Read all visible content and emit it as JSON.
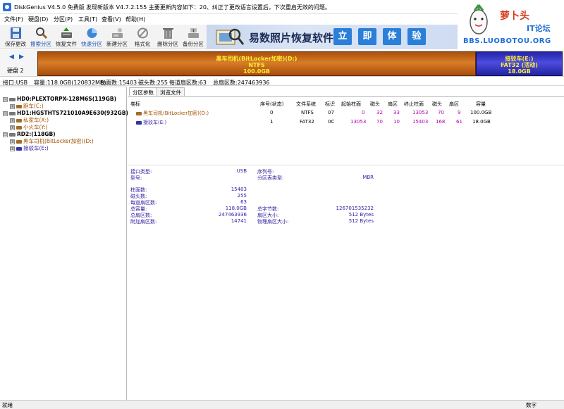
{
  "window": {
    "title": "DiskGenius V4.5.0 免费版",
    "notice": "发现新版本 V4.7.2.155 主要更新内容如下：20、纠正了更改语言设置后，下次重启无效的问题。",
    "minimize": "—",
    "maximize": "☐",
    "close": "✕"
  },
  "menu": [
    "文件(F)",
    "硬盘(D)",
    "分区(P)",
    "工具(T)",
    "查看(V)",
    "帮助(H)"
  ],
  "toolbar": [
    {
      "label": "保存更改",
      "icon": "save-icon"
    },
    {
      "label": "搜索分区",
      "icon": "search-partition-icon"
    },
    {
      "label": "恢复文件",
      "icon": "recover-files-icon"
    },
    {
      "label": "快速分区",
      "icon": "quick-partition-icon"
    },
    {
      "label": "新建分区",
      "icon": "new-partition-icon"
    },
    {
      "label": "格式化",
      "icon": "format-icon"
    },
    {
      "label": "删除分区",
      "icon": "delete-partition-icon"
    },
    {
      "label": "备份分区",
      "icon": "backup-partition-icon"
    }
  ],
  "ad": {
    "text": "易数照片恢复软件",
    "chars": [
      "立",
      "即",
      "体",
      "验"
    ]
  },
  "logo": {
    "title": "萝卜头",
    "sub": "IT论坛",
    "url": "BBS.LUOBOTOU.ORG"
  },
  "diskbar": {
    "label": "硬盘 2",
    "partitions": [
      {
        "name": "黑车司机(BitLocker加密)(D:)",
        "fs": "NTFS",
        "size": "100.0GB"
      },
      {
        "name": "接驳车(E:)",
        "fs": "FAT32 (活动)",
        "size": "18.0GB"
      }
    ]
  },
  "infostrip": {
    "interface": "接口:USB",
    "capacity": "容量:118.0GB(120832MB)",
    "cylinders": "柱面数:15403",
    "heads": "磁头数:255",
    "sectors_per_track": "每道扇区数:63",
    "total_sectors": "总扇区数:247463936"
  },
  "tree": [
    {
      "label": "HD0:PLEXTORPX-128M6S(119GB)",
      "kind": "disk",
      "expander": "⊟"
    },
    {
      "label": "跑车(C:)",
      "kind": "part",
      "expander": "⊞"
    },
    {
      "label": "HD1:HGSTHTS721010A9E630(932GB)",
      "kind": "disk",
      "expander": "⊟"
    },
    {
      "label": "私家车(X:)",
      "kind": "part",
      "expander": "⊞"
    },
    {
      "label": "小火车(Y:)",
      "kind": "part",
      "expander": "⊞"
    },
    {
      "label": "RD2:(118GB)",
      "kind": "disk",
      "expander": "⊟"
    },
    {
      "label": "黑车司机(BitLocker加密)(D:)",
      "kind": "part",
      "expander": "⊞"
    },
    {
      "label": "接驳车(E:)",
      "kind": "part",
      "expander": "⊞"
    }
  ],
  "tabs": [
    "分区参数",
    "浏览文件"
  ],
  "table": {
    "headers": [
      "卷标",
      "序号(状态)",
      "文件系统",
      "标识",
      "起始柱面",
      "磁头",
      "扇区",
      "终止柱面",
      "磁头",
      "扇区",
      "容量"
    ],
    "rows": [
      {
        "label": "黑车司机(BitLocker加密)(D:)",
        "index": "0",
        "fs": "NTFS",
        "id": "07",
        "start_cyl": "0",
        "start_head": "32",
        "start_sec": "33",
        "end_cyl": "13053",
        "end_head": "70",
        "end_sec": "9",
        "capacity": "100.0GB"
      },
      {
        "label": "接驳车(E:)",
        "index": "1",
        "fs": "FAT32",
        "id": "0C",
        "start_cyl": "13053",
        "start_head": "70",
        "start_sec": "10",
        "end_cyl": "15403",
        "end_head": "168",
        "end_sec": "61",
        "capacity": "18.0GB"
      }
    ]
  },
  "props": {
    "interface_type_label": "接口类型:",
    "interface_type": "USB",
    "serial_label": "序列号:",
    "serial": "",
    "model_label": "型号:",
    "model": "",
    "partition_table_label": "分区表类型:",
    "partition_table": "MBR",
    "cylinders_label": "柱面数:",
    "cylinders": "15403",
    "heads_label": "磁头数:",
    "heads": "255",
    "spt_label": "每道扇区数:",
    "spt": "63",
    "total_capacity_label": "总容量:",
    "total_capacity": "118.0GB",
    "total_bytes_label": "总字节数:",
    "total_bytes": "126701535232",
    "total_sectors_label": "总扇区数:",
    "total_sectors": "247463936",
    "sector_size_label": "扇区大小:",
    "sector_size": "512 Bytes",
    "extra_sectors_label": "附加扇区数:",
    "extra_sectors": "14741",
    "phys_sector_label": "物理扇区大小:",
    "phys_sector": "512 Bytes"
  },
  "status": {
    "left": "就绪",
    "right": "数字"
  }
}
